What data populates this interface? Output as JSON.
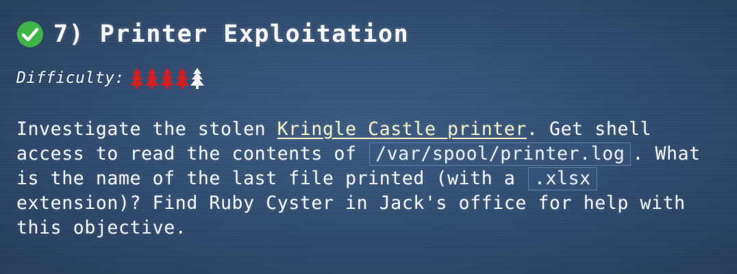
{
  "objective": {
    "title": "7) Printer Exploitation",
    "difficulty_label": "Difficulty:",
    "difficulty": {
      "level": 4,
      "max": 5,
      "filled_color": "#d51d1d",
      "empty_color": "#f2f5fa",
      "icon": "tree-icon"
    },
    "status_icon": "check-circle-icon",
    "status_color": "#3fb547"
  },
  "description": {
    "part1": "Investigate the stolen ",
    "link_text": "Kringle Castle printer",
    "part2": ". Get shell access to read the contents of ",
    "code1": "/var/spool/printer.log",
    "part3": ". What is the name of the last file printed (with a ",
    "code2": ".xlsx",
    "part4": " extension)? Find Ruby Cyster in Jack's office for help with this objective."
  }
}
